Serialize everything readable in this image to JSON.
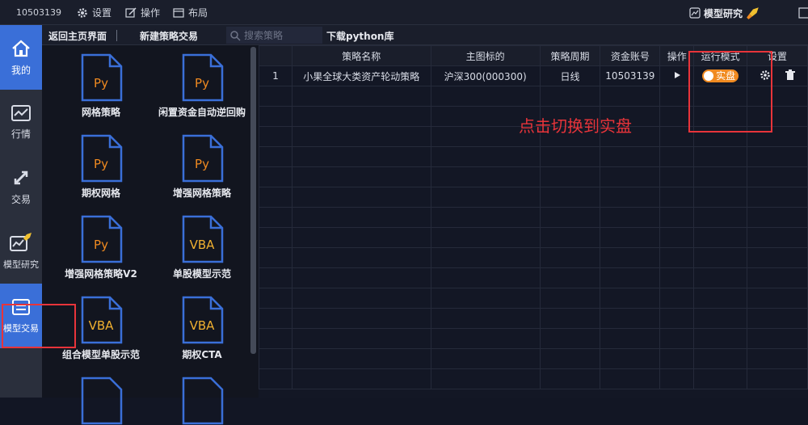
{
  "topbar": {
    "account": "10503139",
    "menu": [
      {
        "label": "设置",
        "icon": "gear-icon"
      },
      {
        "label": "操作",
        "icon": "edit-icon"
      },
      {
        "label": "布局",
        "icon": "layout-icon"
      }
    ],
    "right_label": "模型研究"
  },
  "sidebar": {
    "items": [
      {
        "label": "我的",
        "icon": "home-icon"
      },
      {
        "label": "行情",
        "icon": "chart-icon"
      },
      {
        "label": "交易",
        "icon": "swap-icon"
      },
      {
        "label": "模型研究",
        "icon": "rocket-chart-icon"
      },
      {
        "label": "模型交易",
        "icon": "model-trade-icon"
      }
    ]
  },
  "tabs": {
    "back": "返回主页界面",
    "new_strategy": "新建策略交易",
    "search_placeholder": "搜索策略",
    "download": "下载python库"
  },
  "strategies": [
    {
      "type": "Py",
      "label": "网格策略"
    },
    {
      "type": "Py",
      "label": "闲置资金自动逆回购"
    },
    {
      "type": "Py",
      "label": "期权网格"
    },
    {
      "type": "Py",
      "label": "增强网格策略"
    },
    {
      "type": "Py",
      "label": "增强网格策略V2"
    },
    {
      "type": "VBA",
      "label": "单股模型示范"
    },
    {
      "type": "VBA",
      "label": "组合模型单股示范"
    },
    {
      "type": "VBA",
      "label": "期权CTA"
    }
  ],
  "table": {
    "headers": [
      "",
      "策略名称",
      "主图标的",
      "策略周期",
      "资金账号",
      "操作",
      "运行模式",
      "设置"
    ],
    "rows": [
      {
        "idx": "1",
        "name": "小果全球大类资产轮动策略",
        "symbol": "沪深300(000300)",
        "period": "日线",
        "account": "10503139",
        "mode": "实盘"
      }
    ]
  },
  "annotation": "点击切换到实盘",
  "colors": {
    "accent": "#3a6fd8",
    "toggle": "#f08a20",
    "annotation": "#e8343a"
  }
}
